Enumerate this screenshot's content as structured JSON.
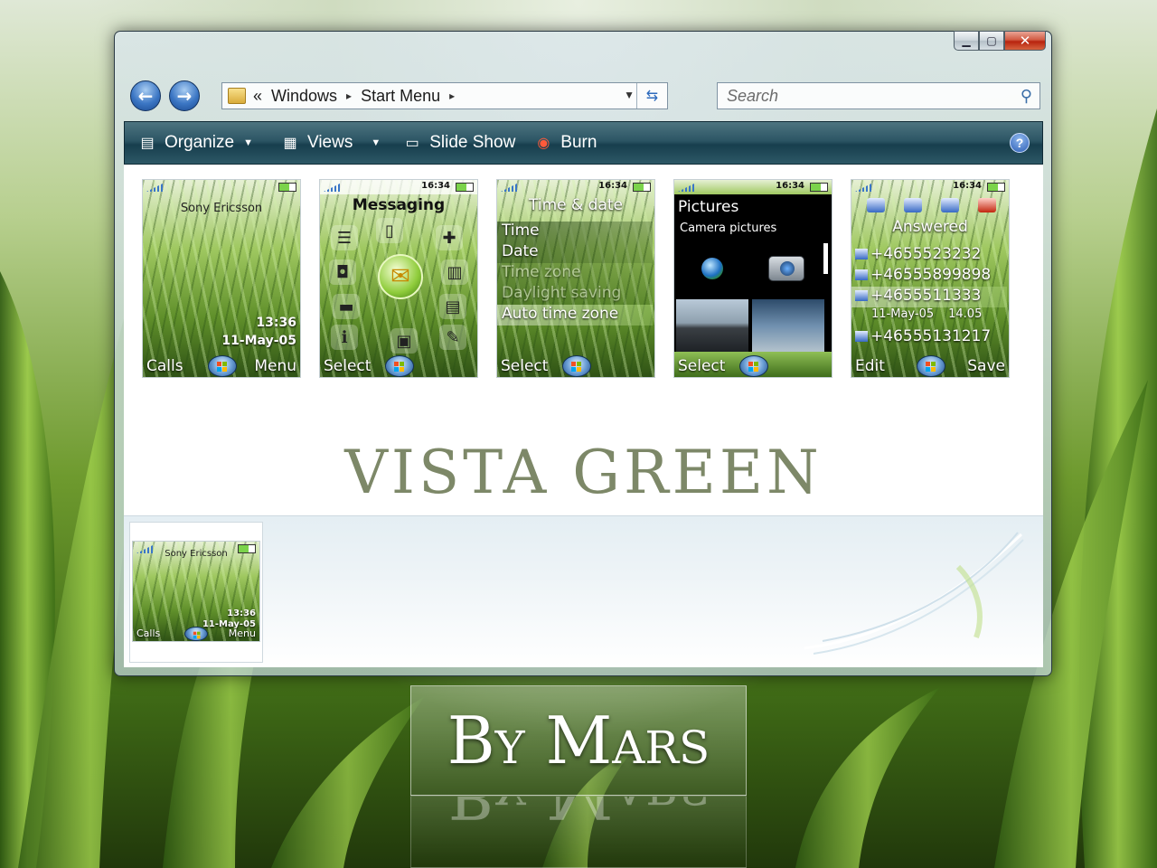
{
  "colors": {
    "toolbar": "#2c5564",
    "close_button": "#c8371b",
    "accent_green": "#7fba00",
    "title_text": "#7d8868"
  },
  "window": {
    "caption": {
      "minimize_glyph": "▁",
      "maximize_glyph": "▢",
      "close_glyph": "✕"
    },
    "nav": {
      "back_glyph": "←",
      "forward_glyph": "→"
    },
    "address": {
      "overflow": "«",
      "crumbs": [
        "Windows",
        "Start Menu"
      ],
      "sep": "▸",
      "dropdown_glyph": "▼",
      "refresh_glyph": "⇆"
    },
    "search": {
      "placeholder": "Search",
      "icon_glyph": "⚲"
    },
    "toolbar": {
      "organize": "Organize",
      "views": "Views",
      "slideshow": "Slide Show",
      "burn": "Burn",
      "caret": "▼",
      "help_glyph": "?"
    }
  },
  "screens": {
    "standby": {
      "brand": "Sony Ericsson",
      "time": "13:36",
      "date": "11-May-05",
      "left": "Calls",
      "right": "Menu"
    },
    "messaging": {
      "clock": "16:34",
      "title": "Messaging",
      "left": "Select"
    },
    "timedate": {
      "clock": "16:34",
      "title": "Time & date",
      "items": [
        "Time",
        "Date",
        "Time zone",
        "Daylight saving",
        "Auto time zone"
      ],
      "left": "Select"
    },
    "pictures": {
      "clock": "16:34",
      "title": "Pictures",
      "subtitle": "Camera pictures",
      "left": "Select"
    },
    "calls": {
      "clock": "16:34",
      "title": "Answered",
      "numbers": [
        "+4655523232",
        "+46555899898",
        "+4655511333",
        "+46555131217"
      ],
      "detail_date": "11-May-05",
      "detail_time": "14.05",
      "left": "Edit",
      "right": "Save"
    }
  },
  "theme_title": "VISTA GREEN",
  "preview": {
    "brand": "Sony Ericsson",
    "time": "13:36",
    "date": "11-May-05",
    "left": "Calls",
    "right": "Menu"
  },
  "author": "By Mars"
}
